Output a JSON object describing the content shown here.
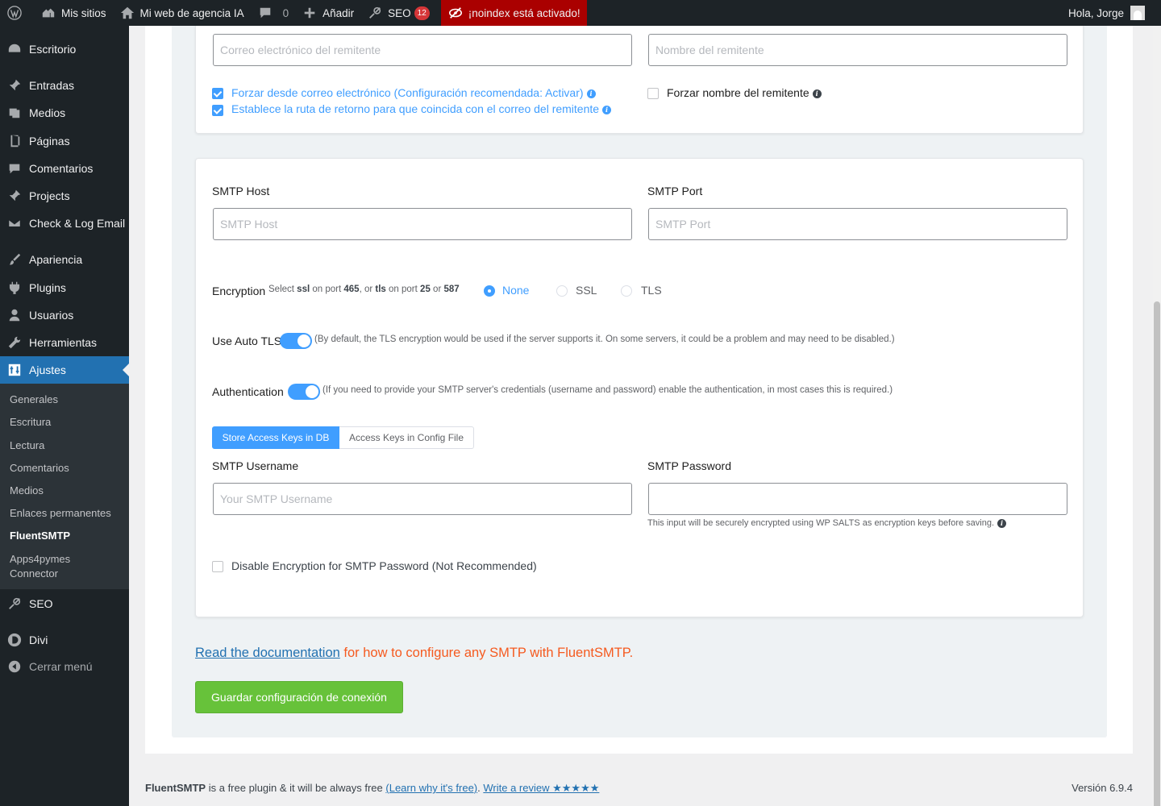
{
  "adminbar": {
    "my_sites": "Mis sitios",
    "site_name": "Mi web de agencia IA",
    "comments_count": "0",
    "add_new": "Añadir",
    "seo": "SEO",
    "seo_badge": "12",
    "noindex": "¡noindex está activado!",
    "greeting": "Hola, Jorge"
  },
  "sidebar": {
    "items": [
      {
        "label": "Escritorio",
        "icon": "dashboard-icon"
      },
      {
        "label": "Entradas",
        "icon": "pin-icon"
      },
      {
        "label": "Medios",
        "icon": "media-icon"
      },
      {
        "label": "Páginas",
        "icon": "page-icon"
      },
      {
        "label": "Comentarios",
        "icon": "comment-icon"
      },
      {
        "label": "Projects",
        "icon": "pin-icon"
      },
      {
        "label": "Check & Log Email",
        "icon": "email-icon"
      },
      {
        "label": "Apariencia",
        "icon": "brush-icon"
      },
      {
        "label": "Plugins",
        "icon": "plugin-icon"
      },
      {
        "label": "Usuarios",
        "icon": "user-icon"
      },
      {
        "label": "Herramientas",
        "icon": "wrench-icon"
      },
      {
        "label": "Ajustes",
        "icon": "settings-icon"
      }
    ],
    "submenu": [
      "Generales",
      "Escritura",
      "Lectura",
      "Comentarios",
      "Medios",
      "Enlaces permanentes",
      "FluentSMTP",
      "Apps4pymes",
      "Connector"
    ],
    "after": [
      {
        "label": "SEO",
        "icon": "seo-icon"
      },
      {
        "label": "Divi",
        "icon": "divi-icon"
      }
    ],
    "collapse": "Cerrar menú"
  },
  "sender": {
    "email_placeholder": "Correo electrónico del remitente",
    "name_placeholder": "Nombre del remitente",
    "force_from_email": "Forzar desde correo electrónico (Configuración recomendada: Activar)",
    "force_from_email_checked": true,
    "return_path": "Establece la ruta de retorno para que coincida con el correo del remitente",
    "return_path_checked": true,
    "force_name": "Forzar nombre del remitente",
    "force_name_checked": false
  },
  "smtp": {
    "host_label": "SMTP Host",
    "host_placeholder": "SMTP Host",
    "port_label": "SMTP Port",
    "port_placeholder": "SMTP Port",
    "encryption_label": "Encryption",
    "encryption_hint": {
      "t1": "Select",
      "ssl": "ssl",
      "t2": "on port",
      "p465": "465",
      "t3": ", or",
      "tls": "tls",
      "t4": "on port",
      "p25": "25",
      "t5": "or",
      "p587": "587"
    },
    "encryption_options": [
      "None",
      "SSL",
      "TLS"
    ],
    "encryption_selected": "None",
    "auto_tls_label": "Use Auto TLS",
    "auto_tls_on": true,
    "auto_tls_hint": "(By default, the TLS encryption would be used if the server supports it. On some servers, it could be a problem and may need to be disabled.)",
    "auth_label": "Authentication",
    "auth_on": true,
    "auth_hint": "(If you need to provide your SMTP server's credentials (username and password) enable the authentication, in most cases this is required.)",
    "keys_tabs": [
      "Store Access Keys in DB",
      "Access Keys in Config File"
    ],
    "username_label": "SMTP Username",
    "username_placeholder": "Your SMTP Username",
    "password_label": "SMTP Password",
    "password_hint": "This input will be securely encrypted using WP SALTS as encryption keys before saving.",
    "disable_encryption": "Disable Encryption for SMTP Password (Not Recommended)",
    "disable_encryption_checked": false
  },
  "doc": {
    "link": "Read the documentation",
    "rest": " for how to configure any SMTP with FluentSMTP."
  },
  "save_button": "Guardar configuración de conexión",
  "footer": {
    "brand": "FluentSMTP",
    "text": " is a free plugin & it will be always free ",
    "why": "(Learn why it's free)",
    "sep": ". ",
    "review": "Write a review ★★★★★",
    "version": "Versión 6.9.4"
  },
  "colors": {
    "accent": "#409eff",
    "wp_blue": "#2271b1",
    "save": "#67c23a",
    "noindex": "#aa0000",
    "doc_text": "#f55a1f"
  }
}
